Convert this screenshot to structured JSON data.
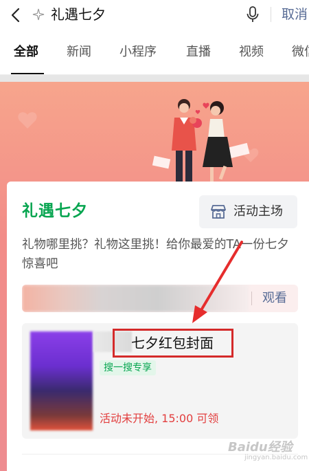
{
  "search": {
    "query": "礼遇七夕",
    "cancel_label": "取消"
  },
  "tabs": [
    {
      "label": "全部",
      "active": true
    },
    {
      "label": "新闻"
    },
    {
      "label": "小程序"
    },
    {
      "label": "直播"
    },
    {
      "label": "视频"
    },
    {
      "label": "微信"
    }
  ],
  "card": {
    "title": "礼遇七夕",
    "host_label": "活动主场",
    "description": "礼物哪里挑？礼物这里挑！给你最爱的TA一份七夕惊喜吧",
    "live_action": "观看"
  },
  "cover": {
    "title": "七夕红包封面",
    "tag": "搜一搜专享",
    "status": "活动未开始, 15:00 可领"
  },
  "watermark": {
    "text": "Baidu经验",
    "sub": "jingyan.baidu.com"
  },
  "colors": {
    "accent_green": "#07a550",
    "link_blue": "#576b95",
    "alert_red": "#e23e3e",
    "banner_pink": "#f28c88"
  },
  "icons": [
    "back-icon",
    "sparkle-icon",
    "microphone-icon",
    "store-icon",
    "arrow-annotation-icon"
  ]
}
